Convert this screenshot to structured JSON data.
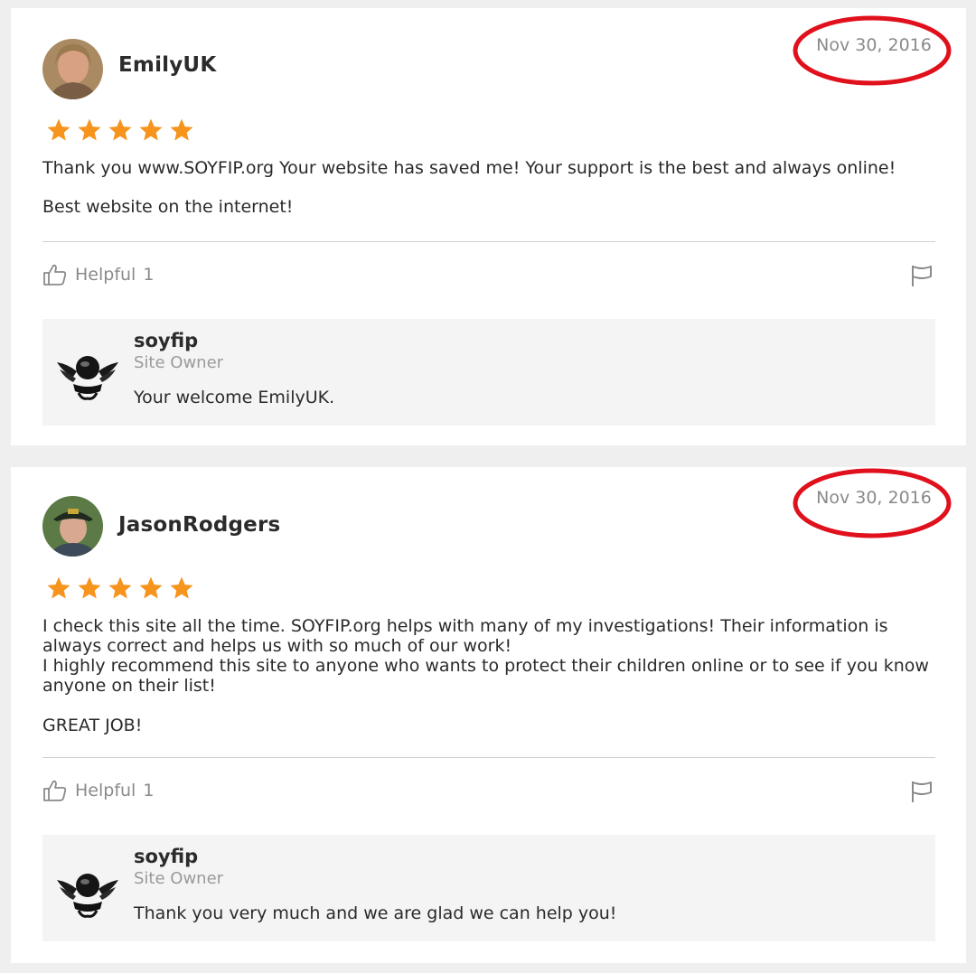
{
  "reviews": [
    {
      "username": "EmilyUK",
      "date": "Nov 30, 2016",
      "rating": 5,
      "paragraphs": [
        "Thank you www.SOYFIP.org  Your website has saved me!  Your support is the best and always online!",
        "Best website on the internet!"
      ],
      "helpful_label": "Helpful",
      "helpful_count": "1",
      "reply": {
        "name": "soyfip",
        "role": "Site Owner",
        "text": "Your welcome EmilyUK."
      }
    },
    {
      "username": "JasonRodgers",
      "date": "Nov 30, 2016",
      "rating": 5,
      "paragraphs": [
        "I check this site all the time.  SOYFIP.org helps with many of my investigations!   Their information is always correct and helps us with so much of our work!",
        "I highly recommend this site to anyone who wants to protect their children online or to see if you know anyone on their list!",
        "GREAT JOB!"
      ],
      "helpful_label": "Helpful",
      "helpful_count": "1",
      "reply": {
        "name": "soyfip",
        "role": "Site Owner",
        "text": "Thank you very much and we are glad we can help you!"
      }
    }
  ],
  "colors": {
    "star": "#f7941d",
    "annotation_circle": "#e0101c",
    "date_text": "#8a8a8a"
  },
  "icons": [
    "star-icon",
    "thumbs-up-icon",
    "flag-icon",
    "eagle-logo-icon"
  ]
}
